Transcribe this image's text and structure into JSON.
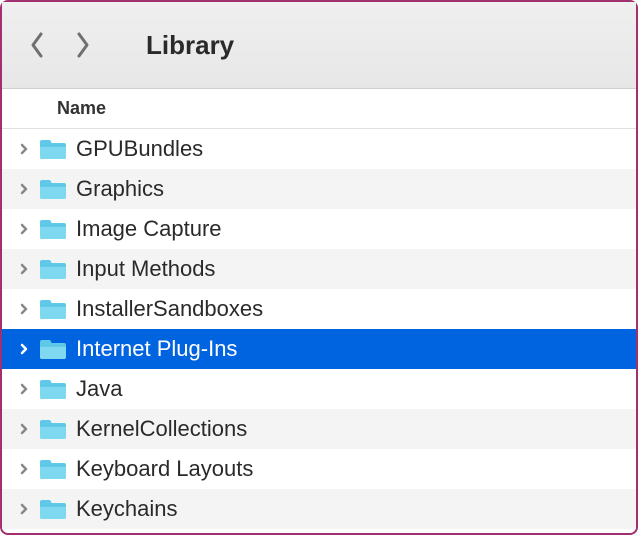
{
  "toolbar": {
    "title": "Library"
  },
  "header": {
    "column_name": "Name"
  },
  "items": [
    {
      "name": "GPUBundles",
      "selected": false
    },
    {
      "name": "Graphics",
      "selected": false
    },
    {
      "name": "Image Capture",
      "selected": false
    },
    {
      "name": "Input Methods",
      "selected": false
    },
    {
      "name": "InstallerSandboxes",
      "selected": false
    },
    {
      "name": "Internet Plug-Ins",
      "selected": true
    },
    {
      "name": "Java",
      "selected": false
    },
    {
      "name": "KernelCollections",
      "selected": false
    },
    {
      "name": "Keyboard Layouts",
      "selected": false
    },
    {
      "name": "Keychains",
      "selected": false
    }
  ]
}
